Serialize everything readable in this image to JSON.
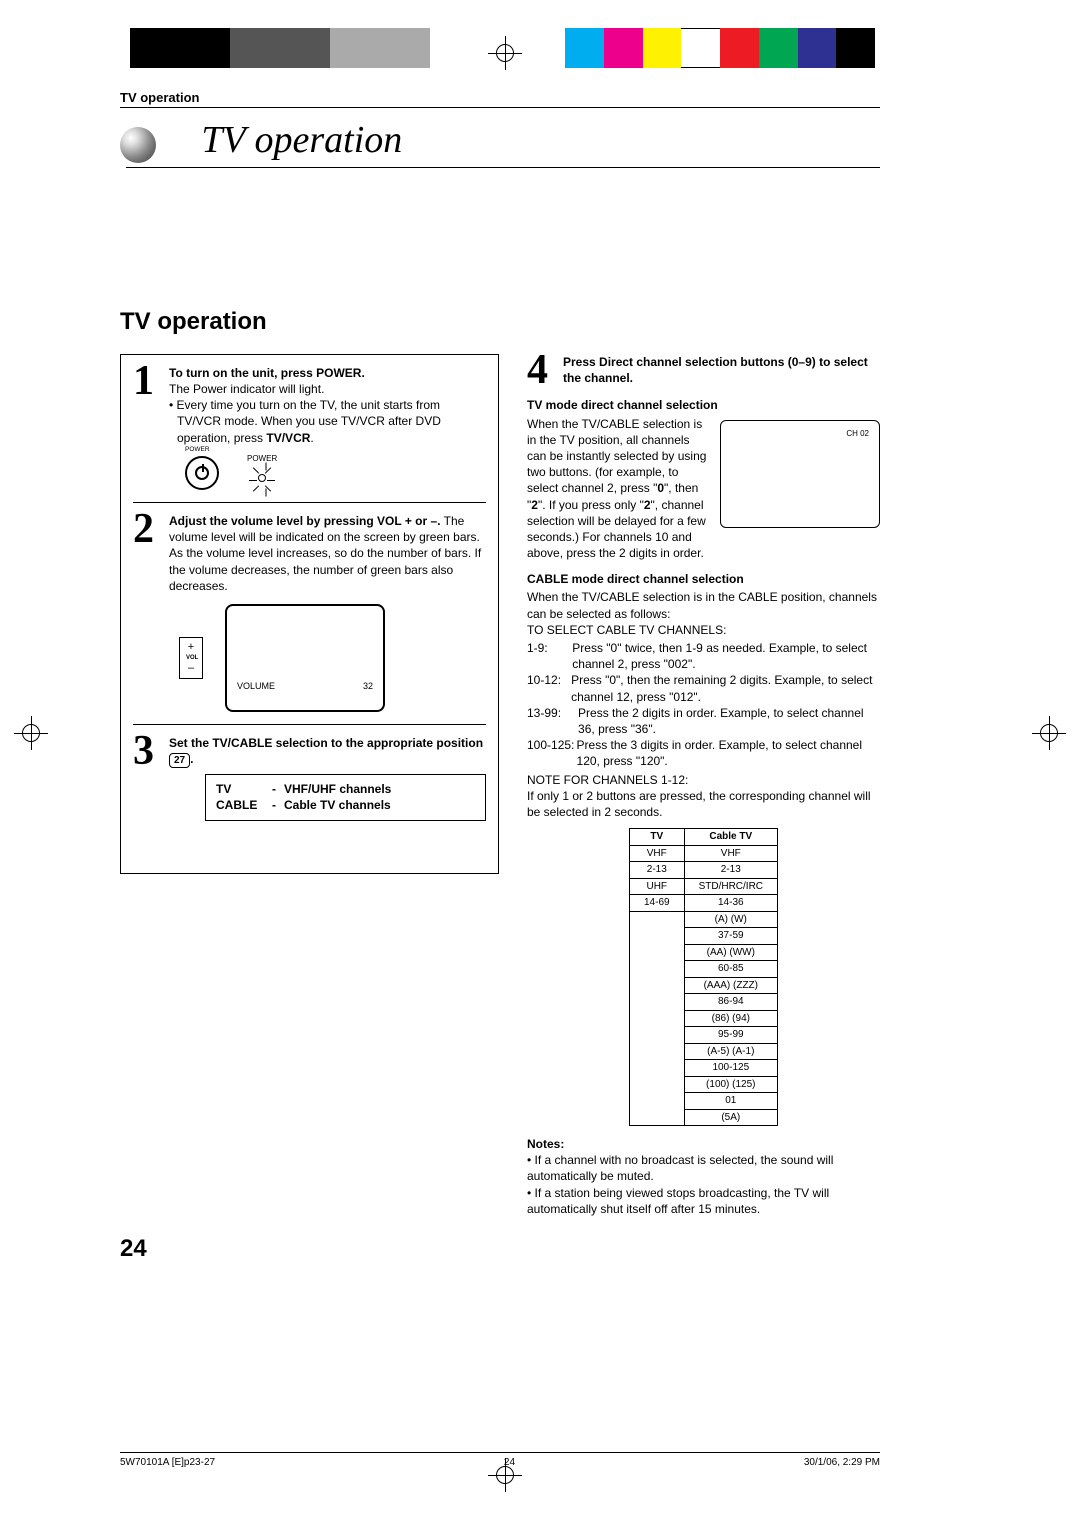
{
  "header_label": "TV operation",
  "chapter_title": "TV operation",
  "section_title": "TV operation",
  "step1": {
    "title": "To turn on the unit, press POWER.",
    "line1": "The Power indicator will light.",
    "bullet": "Every time you turn on the TV, the unit starts from TV/VCR mode. When you use TV/VCR after DVD operation, press ",
    "bullet_bold": "TV/VCR",
    "bullet_end": ".",
    "power_label": "POWER",
    "led_label": "POWER"
  },
  "step2": {
    "title": "Adjust the volume level by pressing VOL + or –.",
    "body": "The volume level will be indicated on the screen by green bars. As the volume level increases, so do the number of bars. If the volume decreases, the number of green bars also decreases.",
    "vol_label": "VOL",
    "osd_label": "VOLUME",
    "osd_value": "32"
  },
  "step3": {
    "title_a": "Set the TV/CABLE selection to the appropriate position ",
    "page_ref": "27",
    "title_b": ".",
    "rows": [
      {
        "k": "TV",
        "sep": "-",
        "v": "VHF/UHF channels"
      },
      {
        "k": "CABLE",
        "sep": "-",
        "v": "Cable TV channels"
      }
    ]
  },
  "step4": {
    "title": "Press Direct channel selection buttons (0–9) to select the channel.",
    "tv_head": "TV mode direct channel selection",
    "tv_body_a": "When the TV/CABLE selection is in the TV position, all channels can be instantly selected by using two buttons. (for example, to select channel 2, press \"",
    "tv_body_b": "0",
    "tv_body_c": "\", then \"",
    "tv_body_d": "2",
    "tv_body_e": "\". If you press only \"",
    "tv_body_f": "2",
    "tv_body_g": "\", channel selection will be delayed for a few seconds.) For channels 10 and above, press the 2 digits in order.",
    "ch_osd": "CH 02",
    "cable_head": "CABLE mode direct channel selection",
    "cable_intro": "When the TV/CABLE selection is in the CABLE position, channels can be selected as follows:",
    "cable_select_label": "TO SELECT CABLE TV CHANNELS:",
    "cable_rows": [
      {
        "k": "1-9:",
        "v": "Press \"0\" twice, then 1-9 as needed. Example, to select channel 2, press \"002\"."
      },
      {
        "k": "10-12:",
        "v": "Press \"0\", then the remaining 2 digits. Example, to select channel 12, press \"012\"."
      },
      {
        "k": "13-99:",
        "v": "Press the 2 digits in order. Example, to select channel 36, press \"36\"."
      },
      {
        "k": "100-125:",
        "v": "Press the 3 digits in order. Example, to select channel 120, press \"120\"."
      }
    ],
    "note_ch_label": "NOTE FOR CHANNELS 1-12:",
    "note_ch_body": "If only 1 or 2 buttons are pressed, the corresponding channel will be selected in 2 seconds.",
    "table": {
      "head": [
        "TV",
        "Cable TV"
      ],
      "rows": [
        [
          "VHF",
          "VHF"
        ],
        [
          "2-13",
          "2-13"
        ],
        [
          "UHF",
          "STD/HRC/IRC"
        ],
        [
          "14-69",
          "14-36"
        ],
        [
          "",
          "(A) (W)"
        ],
        [
          "",
          "37-59"
        ],
        [
          "",
          "(AA) (WW)"
        ],
        [
          "",
          "60-85"
        ],
        [
          "",
          "(AAA) (ZZZ)"
        ],
        [
          "",
          "86-94"
        ],
        [
          "",
          "(86) (94)"
        ],
        [
          "",
          "95-99"
        ],
        [
          "",
          "(A-5) (A-1)"
        ],
        [
          "",
          "100-125"
        ],
        [
          "",
          "(100) (125)"
        ],
        [
          "",
          "01"
        ],
        [
          "",
          "(5A)"
        ]
      ]
    }
  },
  "notes": {
    "head": "Notes:",
    "items": [
      "If a channel with no broadcast is selected, the sound will automatically be muted.",
      "If a station being viewed stops broadcasting, the TV will automatically shut itself off after 15 minutes."
    ]
  },
  "page_number": "24",
  "footer": {
    "left": "5W70101A [E]p23-27",
    "center": "24",
    "right": "30/1/06, 2:29 PM"
  }
}
